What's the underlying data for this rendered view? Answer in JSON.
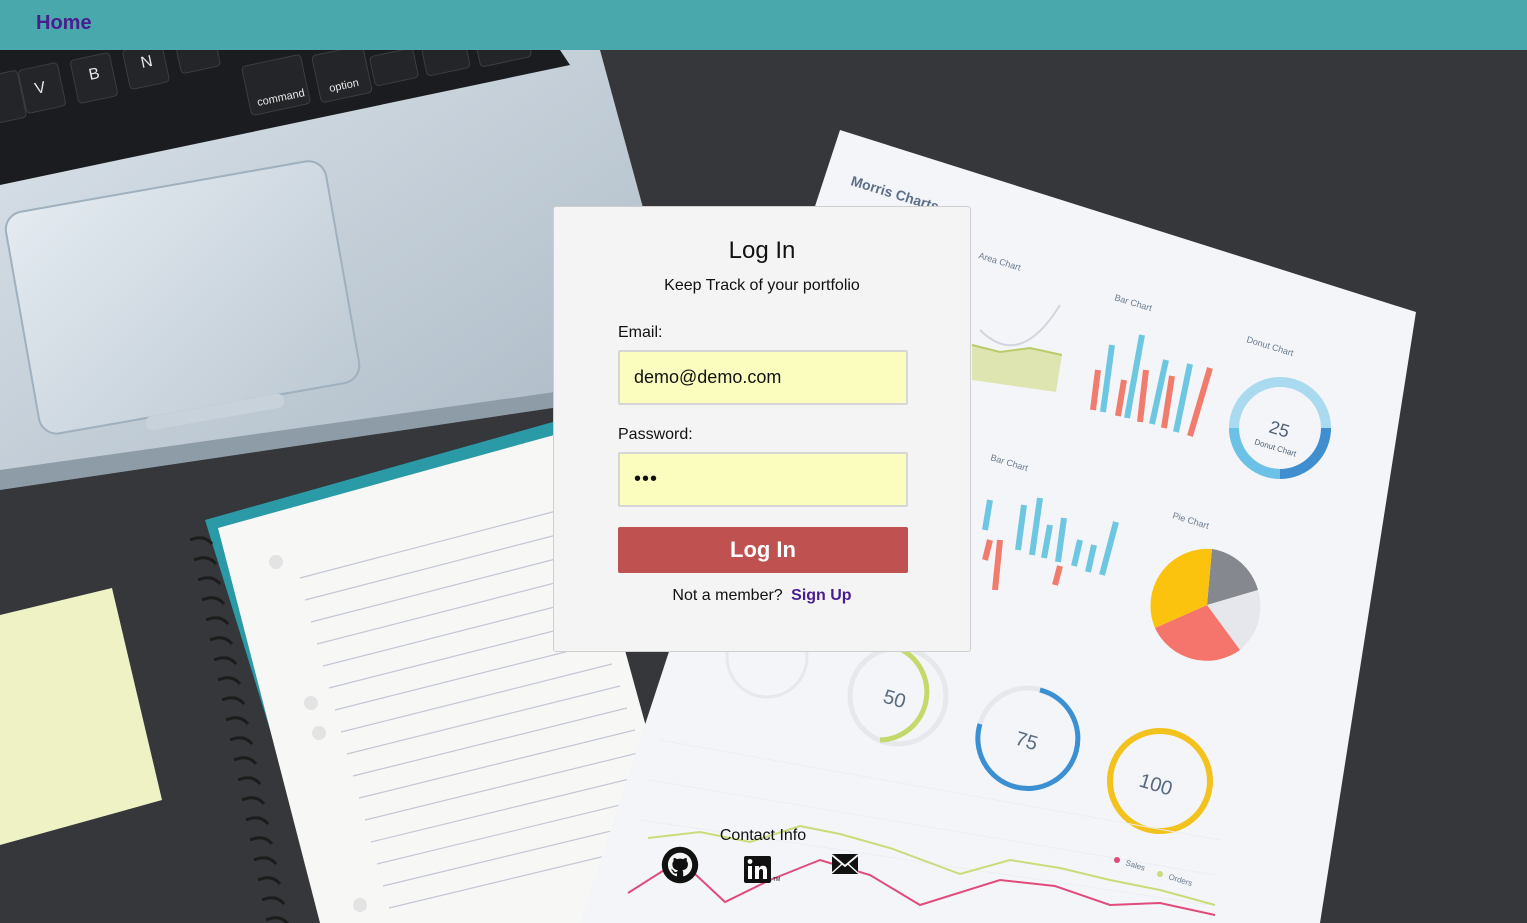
{
  "navbar": {
    "home_label": "Home"
  },
  "login": {
    "title": "Log In",
    "subtitle": "Keep Track of your portfolio",
    "email_label": "Email:",
    "email_value": "demo@demo.com",
    "password_label": "Password:",
    "password_value": "•••",
    "submit_label": "Log In",
    "signup_prompt": "Not a member?",
    "signup_link": "Sign Up"
  },
  "footer": {
    "contact_title": "Contact Info",
    "icons": [
      "github-icon",
      "linkedin-icon",
      "email-icon"
    ]
  },
  "background_text": {
    "sheet_title": "Morris Charts",
    "area_chart": "Area Chart",
    "bar_chart": "Bar Chart",
    "donut_chart": "Donut Chart",
    "bar_chart_2": "Bar Chart",
    "pie_chart": "Pie Chart",
    "donut_value": "25",
    "donut_label": "Donut Chart",
    "gauge_50": "50",
    "gauge_75": "75",
    "gauge_100": "100",
    "gauge_unit": "%",
    "key_command": "command",
    "key_option": "option",
    "key_v": "V",
    "key_b": "B",
    "key_n": "N",
    "legend_sales": "Sales",
    "legend_orders": "Orders"
  },
  "colors": {
    "navbar": "#48a8ab",
    "nav_link": "#4a1d8f",
    "button": "#c05151",
    "input_bg": "#fbfdbf",
    "card_bg": "#f4f4f4"
  }
}
